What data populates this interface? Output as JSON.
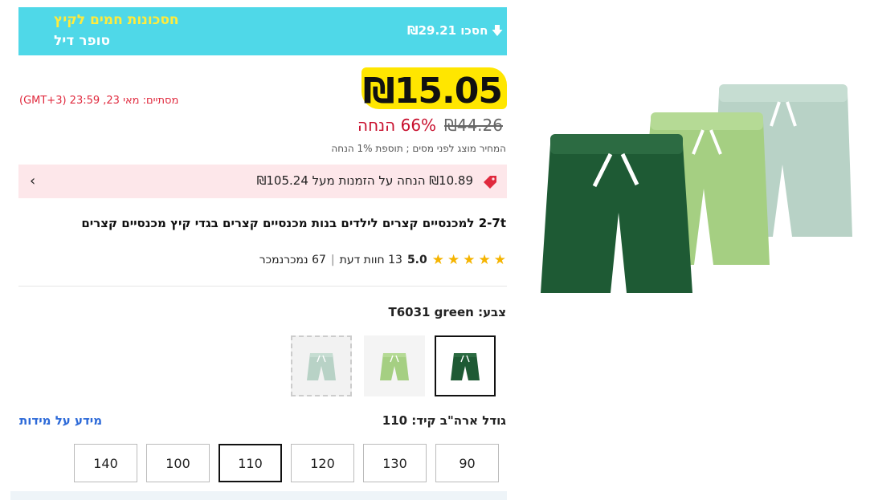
{
  "banner": {
    "save_amount": "₪29.21 חסכו",
    "deal_title": "חסכונות חמים לקיץ",
    "deal_subtitle": "סופר דיל"
  },
  "price": {
    "current": "₪15.05",
    "ends_text": "(GMT+3) 23:59 ,23 מסתיים:  מאי",
    "original": "₪44.26",
    "discount": "66% הנחה",
    "tax_note": "המחיר מוצג לפני מסים ; תוספת 1% הנחה"
  },
  "coupon": {
    "text": "₪10.89 הנחה על הזמנות מעל ₪105.24",
    "icon": "tag-icon"
  },
  "product": {
    "title": "2-7t למכנסיים קצרים לילדים בנות מכנסיים קצרים בגדי קיץ מכנסיים קצרים"
  },
  "rating": {
    "score": "5.0",
    "reviews": "13 חוות דעת",
    "sold": "67 נמכרנמכר",
    "stars": 5
  },
  "color": {
    "label": "צבע: T6031 green",
    "swatches": [
      {
        "name": "green",
        "color": "#1e5a34"
      },
      {
        "name": "light-green",
        "color": "#a5cf82"
      },
      {
        "name": "mint",
        "color": "#b8d2c6"
      }
    ]
  },
  "size": {
    "label": "גודל ארה\"ב קיד: 110",
    "guide": "מידע על מידות",
    "options": [
      "90",
      "130",
      "120",
      "110",
      "100",
      "140"
    ],
    "selected": "110"
  },
  "colors": {
    "accent_cyan": "#4fd8e8",
    "price_yellow": "#ffe600",
    "discount_red": "#c8102e",
    "link_blue": "#2d6ad8"
  }
}
